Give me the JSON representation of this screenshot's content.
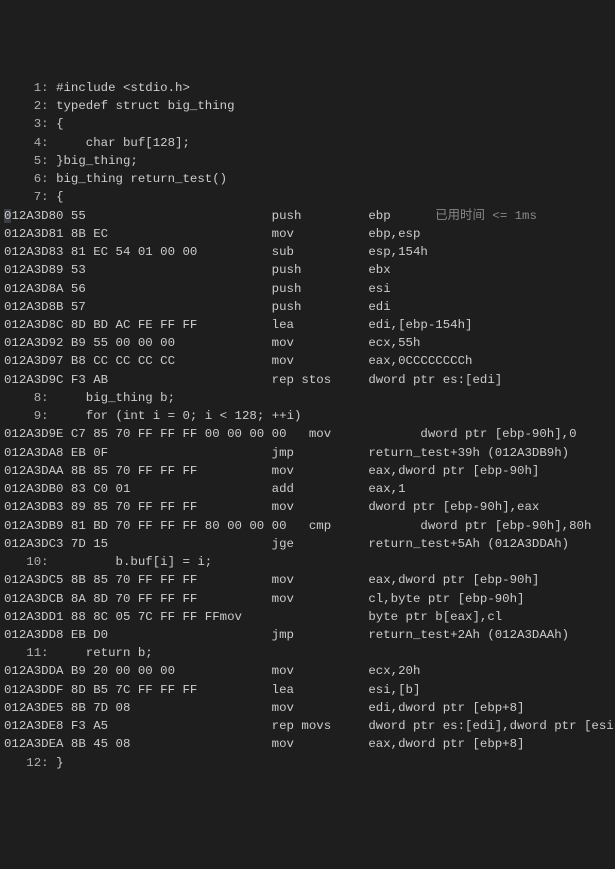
{
  "hint_label": "已用时间 <= 1ms",
  "lines": [
    {
      "type": "src",
      "ln": "1:",
      "text": "#include <stdio.h>"
    },
    {
      "type": "src",
      "ln": "2:",
      "text": "typedef struct big_thing"
    },
    {
      "type": "src",
      "ln": "3:",
      "text": "{"
    },
    {
      "type": "src",
      "ln": "4:",
      "text": "    char buf[128];"
    },
    {
      "type": "src",
      "ln": "5:",
      "text": "}big_thing;"
    },
    {
      "type": "src",
      "ln": "6:",
      "text": "big_thing return_test()"
    },
    {
      "type": "src",
      "ln": "7:",
      "text": "{"
    },
    {
      "type": "asm",
      "addr": "012A3D80",
      "hex": "55",
      "mnem": "push",
      "ops": "ebp",
      "hint": true,
      "caret": true
    },
    {
      "type": "asm",
      "addr": "012A3D81",
      "hex": "8B EC",
      "mnem": "mov",
      "ops": "ebp,esp"
    },
    {
      "type": "asm",
      "addr": "012A3D83",
      "hex": "81 EC 54 01 00 00",
      "mnem": "sub",
      "ops": "esp,154h"
    },
    {
      "type": "asm",
      "addr": "012A3D89",
      "hex": "53",
      "mnem": "push",
      "ops": "ebx"
    },
    {
      "type": "asm",
      "addr": "012A3D8A",
      "hex": "56",
      "mnem": "push",
      "ops": "esi"
    },
    {
      "type": "asm",
      "addr": "012A3D8B",
      "hex": "57",
      "mnem": "push",
      "ops": "edi"
    },
    {
      "type": "asm",
      "addr": "012A3D8C",
      "hex": "8D BD AC FE FF FF",
      "mnem": "lea",
      "ops": "edi,[ebp-154h]"
    },
    {
      "type": "asm",
      "addr": "012A3D92",
      "hex": "B9 55 00 00 00",
      "mnem": "mov",
      "ops": "ecx,55h"
    },
    {
      "type": "asm",
      "addr": "012A3D97",
      "hex": "B8 CC CC CC CC",
      "mnem": "mov",
      "ops": "eax,0CCCCCCCCh"
    },
    {
      "type": "asm",
      "addr": "012A3D9C",
      "hex": "F3 AB",
      "mnem": "rep stos",
      "ops": "dword ptr es:[edi]"
    },
    {
      "type": "src",
      "ln": "8:",
      "text": "    big_thing b;"
    },
    {
      "type": "src",
      "ln": "9:",
      "text": "    for (int i = 0; i < 128; ++i)"
    },
    {
      "type": "asm2",
      "addr": "012A3D9E",
      "hex": "C7 85 70 FF FF FF 00 00 00 00",
      "mnem": "mov",
      "ops": "dword ptr [ebp-90h],0"
    },
    {
      "type": "asm",
      "addr": "012A3DA8",
      "hex": "EB 0F",
      "mnem": "jmp",
      "ops": "return_test+39h (012A3DB9h)"
    },
    {
      "type": "asm",
      "addr": "012A3DAA",
      "hex": "8B 85 70 FF FF FF",
      "mnem": "mov",
      "ops": "eax,dword ptr [ebp-90h]"
    },
    {
      "type": "asm",
      "addr": "012A3DB0",
      "hex": "83 C0 01",
      "mnem": "add",
      "ops": "eax,1"
    },
    {
      "type": "asm",
      "addr": "012A3DB3",
      "hex": "89 85 70 FF FF FF",
      "mnem": "mov",
      "ops": "dword ptr [ebp-90h],eax"
    },
    {
      "type": "asm2",
      "addr": "012A3DB9",
      "hex": "81 BD 70 FF FF FF 80 00 00 00",
      "mnem": "cmp",
      "ops": "dword ptr [ebp-90h],80h"
    },
    {
      "type": "asm",
      "addr": "012A3DC3",
      "hex": "7D 15",
      "mnem": "jge",
      "ops": "return_test+5Ah (012A3DDAh)"
    },
    {
      "type": "src",
      "ln": "10:",
      "text": "        b.buf[i] = i;"
    },
    {
      "type": "asm",
      "addr": "012A3DC5",
      "hex": "8B 85 70 FF FF FF",
      "mnem": "mov",
      "ops": "eax,dword ptr [ebp-90h]"
    },
    {
      "type": "asm",
      "addr": "012A3DCB",
      "hex": "8A 8D 70 FF FF FF",
      "mnem": "mov",
      "ops": "cl,byte ptr [ebp-90h]"
    },
    {
      "type": "asm",
      "addr": "012A3DD1",
      "hex": "88 8C 05 7C FF FF FF",
      "mnem": "mov",
      "ops": "byte ptr b[eax],cl",
      "mcol": 29
    },
    {
      "type": "asm",
      "addr": "012A3DD8",
      "hex": "EB D0",
      "mnem": "jmp",
      "ops": "return_test+2Ah (012A3DAAh)"
    },
    {
      "type": "src",
      "ln": "11:",
      "text": "    return b;"
    },
    {
      "type": "asm",
      "addr": "012A3DDA",
      "hex": "B9 20 00 00 00",
      "mnem": "mov",
      "ops": "ecx,20h"
    },
    {
      "type": "asm",
      "addr": "012A3DDF",
      "hex": "8D B5 7C FF FF FF",
      "mnem": "lea",
      "ops": "esi,[b]"
    },
    {
      "type": "asm",
      "addr": "012A3DE5",
      "hex": "8B 7D 08",
      "mnem": "mov",
      "ops": "edi,dword ptr [ebp+8]"
    },
    {
      "type": "asm",
      "addr": "012A3DE8",
      "hex": "F3 A5",
      "mnem": "rep movs",
      "ops": "dword ptr es:[edi],dword ptr [esi]"
    },
    {
      "type": "asm",
      "addr": "012A3DEA",
      "hex": "8B 45 08",
      "mnem": "mov",
      "ops": "eax,dword ptr [ebp+8]"
    },
    {
      "type": "src",
      "ln": "12:",
      "text": "}"
    }
  ]
}
